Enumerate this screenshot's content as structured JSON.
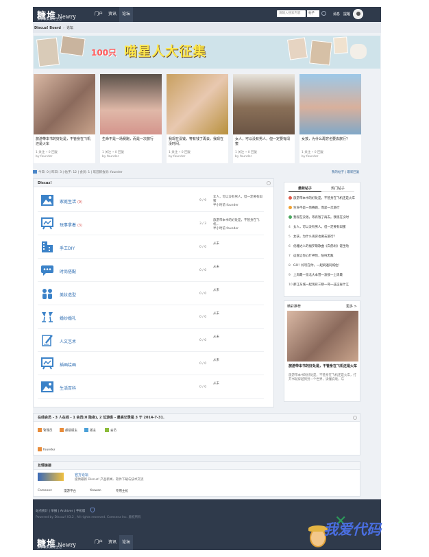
{
  "header": {
    "logo_main": "糖堆",
    "logo_sub": "Newry",
    "tagline": "分享收集美好生活",
    "nav": [
      "门户",
      "资讯",
      "论坛"
    ],
    "search_placeholder": "请输入搜索内容",
    "search_type": "帖子",
    "messages": "消息",
    "reminders": "提醒"
  },
  "breadcrumb": {
    "home": "Discuz! Board",
    "current": "论坛"
  },
  "banner": {
    "number": "100只",
    "title": "喵星人大征集"
  },
  "cards": [
    {
      "title": "旅游带本书的好处是，不管身在飞机还是火车",
      "meta1": "1 关注 • 0 回复",
      "meta2": "by founder"
    },
    {
      "title": "生命不是一场赛跑，而是一次旅行",
      "meta1": "1 关注 • 0 回复",
      "meta2": "by founder"
    },
    {
      "title": "我现在没钱，等有钱了再去。我现在没时间，",
      "meta1": "1 关注 • 0 回复",
      "meta2": "by founder"
    },
    {
      "title": "女人，可以没有男人，但一定要有闺蜜",
      "meta1": "1 关注 • 0 回复",
      "meta2": "by founder"
    },
    {
      "title": "女孩，为什么再穷也要去旅行？",
      "meta1": "1 关注 • 0 回复",
      "meta2": "by founder"
    }
  ],
  "stats": {
    "text": "今日: 0 | 昨日: 3 | 帖子: 12 | 会员: 1 | 欢迎新会员: founder",
    "right": "我的帖子 | 最新回复"
  },
  "forum": {
    "title": "Discuz!",
    "boards": [
      {
        "name": "家庭生活",
        "new": "(9)",
        "count": "9 / 9",
        "last1": "女人，可以没有男人，但一定要有闺蜜",
        "last2": "半小时前 founder",
        "icon": "image-icon"
      },
      {
        "name": "玩事拿着",
        "new": "(3)",
        "count": "3 / 3",
        "last1": "旅游带本书的好处是，不管身在飞机...",
        "last2": "半小时前 founder",
        "icon": "easel-icon"
      },
      {
        "name": "手工DIY",
        "new": "",
        "count": "0 / 0",
        "last1": "从未",
        "last2": "",
        "icon": "building-icon"
      },
      {
        "name": "时尚搭配",
        "new": "",
        "count": "0 / 0",
        "last1": "从未",
        "last2": "",
        "icon": "chat-icon"
      },
      {
        "name": "美妆造型",
        "new": "",
        "count": "0 / 0",
        "last1": "从未",
        "last2": "",
        "icon": "people-icon"
      },
      {
        "name": "婚纱婚礼",
        "new": "",
        "count": "0 / 0",
        "last1": "从未",
        "last2": "",
        "icon": "cheers-icon"
      },
      {
        "name": "人文艺术",
        "new": "",
        "count": "0 / 0",
        "last1": "从未",
        "last2": "",
        "icon": "pen-icon"
      },
      {
        "name": "插画绘画",
        "new": "",
        "count": "0 / 0",
        "last1": "从未",
        "last2": "",
        "icon": "easel-icon"
      },
      {
        "name": "生活百科",
        "new": "",
        "count": "0 / 0",
        "last1": "从未",
        "last2": "",
        "icon": "image-icon"
      }
    ]
  },
  "sidebar": {
    "tab_new": "最新帖子",
    "tab_hot": "热门帖子",
    "hot": [
      {
        "n": "",
        "text": "旅游带本书的好处是，不管身在飞机还是火车",
        "color": "#e05a4a"
      },
      {
        "n": "",
        "text": "生命不是一场赛跑，而是一次旅行",
        "color": "#f0a030"
      },
      {
        "n": "",
        "text": "我现在没钱，等有钱了再去。我现在没时",
        "color": "#4aa860"
      },
      {
        "n": "4",
        "text": "女人，可以没有男人，但一定要有闺蜜",
        "color": ""
      },
      {
        "n": "5",
        "text": "女孩，为什么再穷也要去旅行？",
        "color": ""
      },
      {
        "n": "6",
        "text": "优雅达人的福罗斯歌曲《白鸽树》诞生啦",
        "color": ""
      },
      {
        "n": "7",
        "text": "这盘让你心旷神怡，陪纯无敌",
        "color": ""
      },
      {
        "n": "8",
        "text": "GO！好玩在你，一起刷遍同城住！",
        "color": ""
      },
      {
        "n": "9",
        "text": "上周最一览北大本营一波接一上周最",
        "color": ""
      },
      {
        "n": "10",
        "text": "那江东城一起现彩三聊一哥一这这省什江",
        "color": ""
      }
    ],
    "rec_title": "精彩推荐",
    "rec_more": "更多 >",
    "rec_post_title": "旅游带本书的好处是，不管身在飞机还是火车",
    "rec_post_desc": "旅游带本书的好处是，不管身在飞机还是火车，打开书就穿越到另一个世界，读懂说境，与"
  },
  "online": {
    "title": "在线会员 - 3 人在线 - 1 会员(0 隐身), 2 位游客 - 最高记录是 3 于 2014-7-31.",
    "legend": [
      {
        "label": "管理员",
        "color": "#e88c3a"
      },
      {
        "label": "超级版主",
        "color": "#e88c3a"
      },
      {
        "label": "版主",
        "color": "#4aa0d8"
      },
      {
        "label": "会员",
        "color": "#8cbc3a"
      }
    ],
    "member": "founder"
  },
  "links": {
    "title": "友情链接",
    "official_name": "官方论坛",
    "official_desc": "提供最新 Discuz! 产品新闻、软件下载与技术交流",
    "items": [
      "Comsenz",
      "漫游平台",
      "Yeswan",
      "专用主机"
    ]
  },
  "footer": {
    "links": "站点统计 | 举报 | Archiver | 手机版",
    "copy": "Powered by Discuz! X3.2 , All rights reserved. Comsenz Inc. 版权所有"
  },
  "watermark": {
    "text": "我爱代码"
  },
  "colors": {
    "header_bg": "#2f3a4b",
    "link": "#2a6ab0",
    "page_bg": "#eef1f5"
  }
}
